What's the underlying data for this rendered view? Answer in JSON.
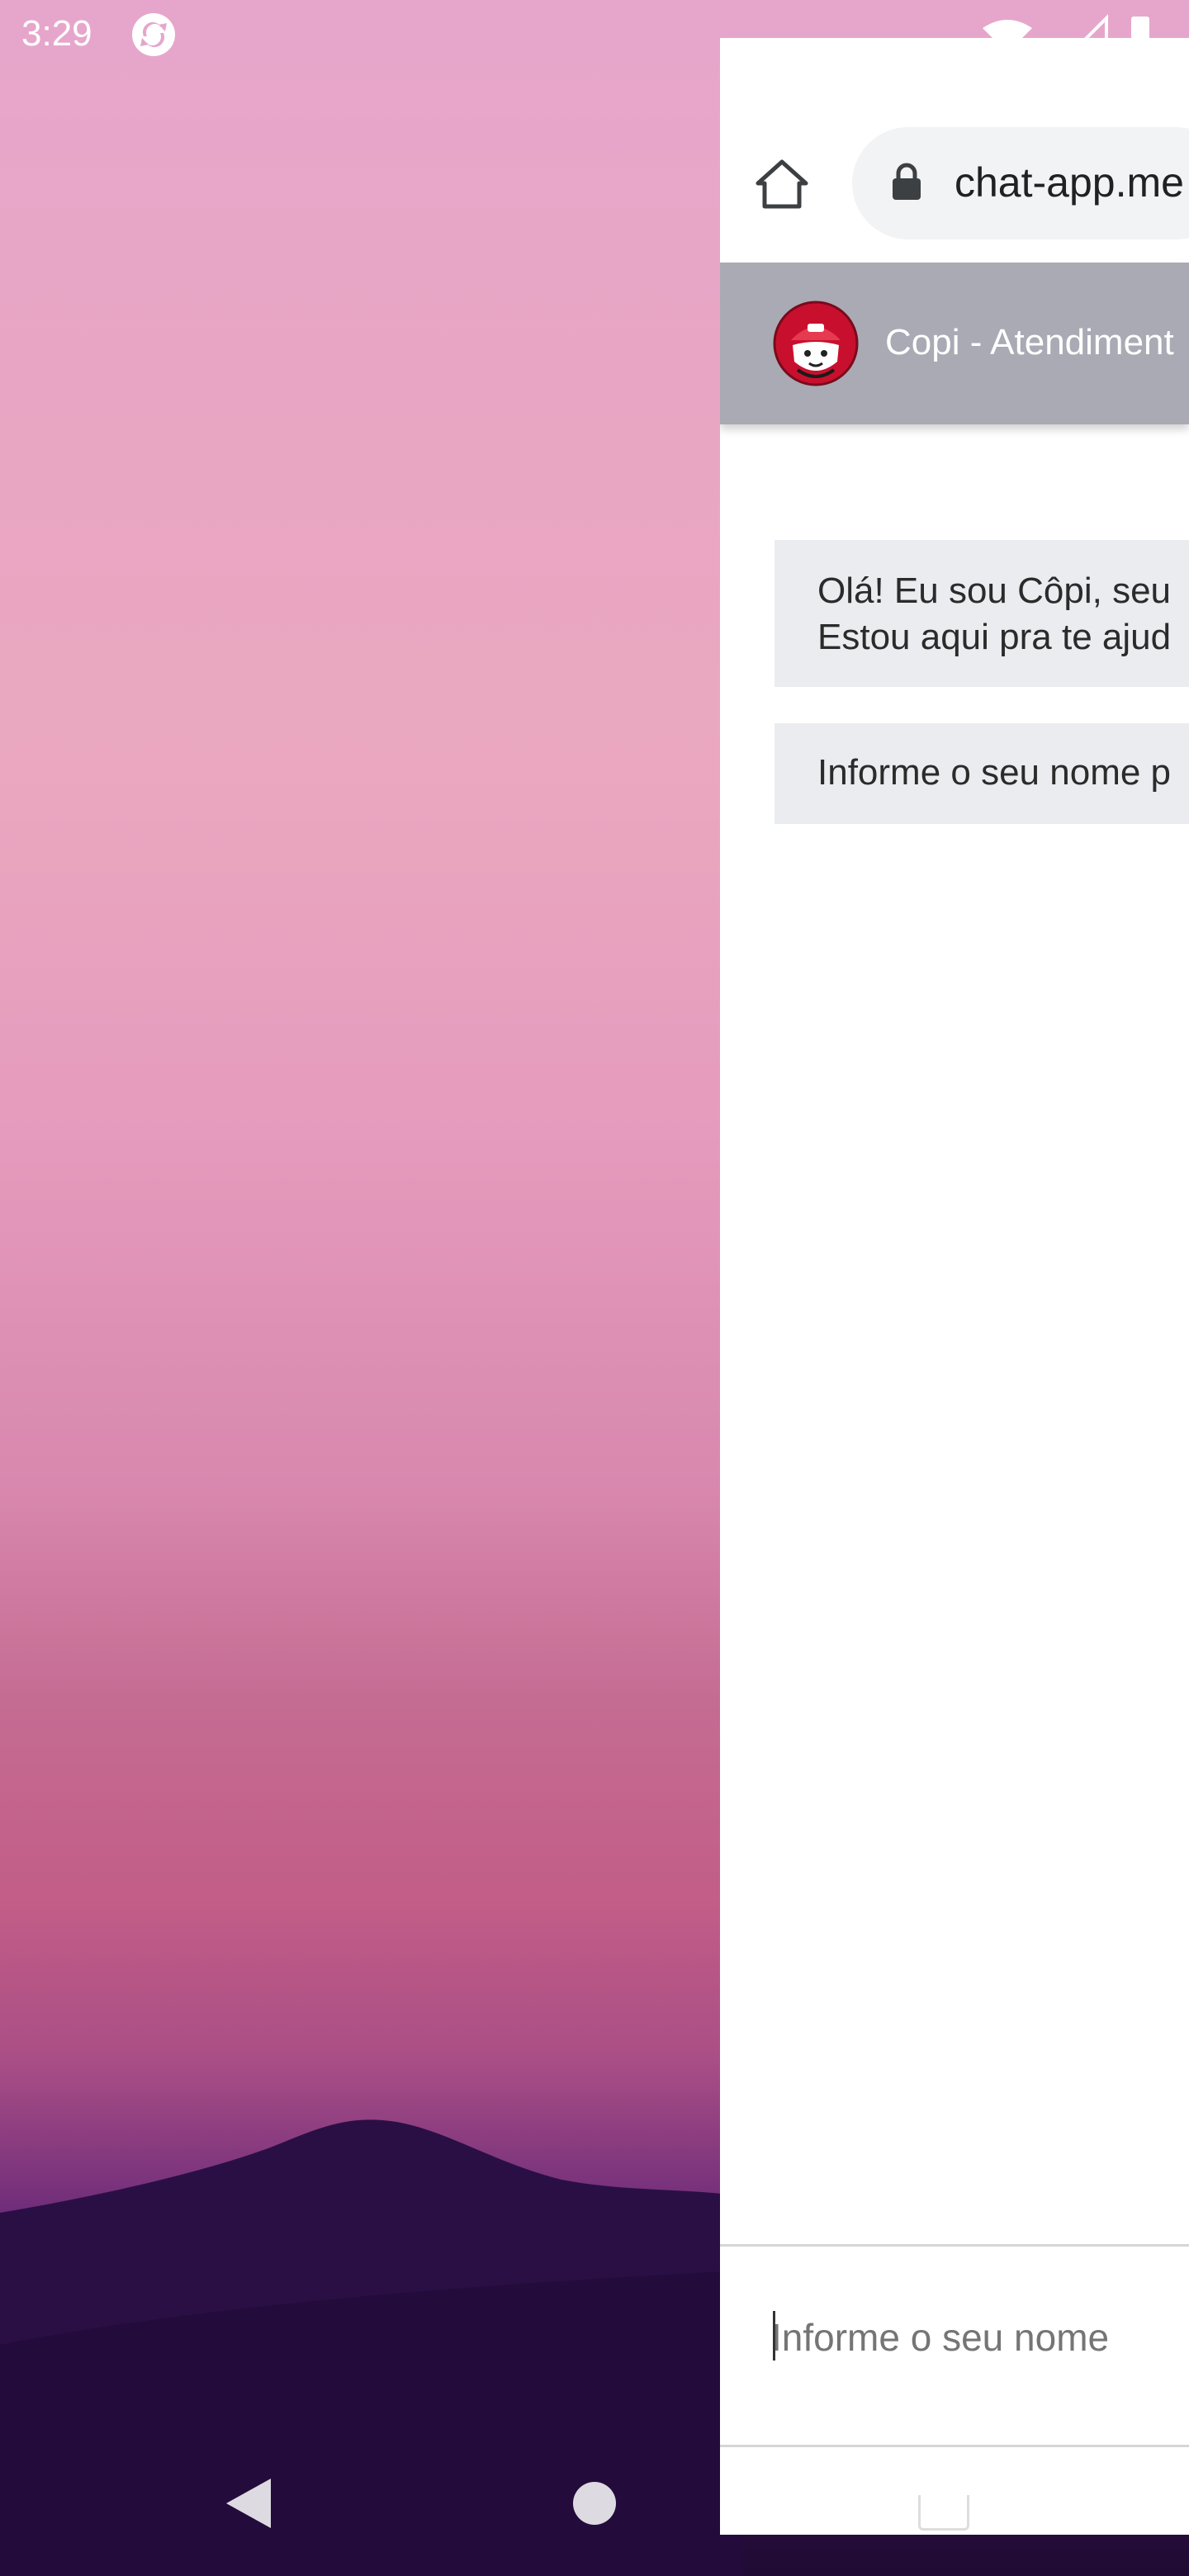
{
  "status_bar": {
    "time": "3:29",
    "app_icon": "sync-app-icon",
    "right_icons": [
      "wifi-icon",
      "signal-icon",
      "battery-icon"
    ]
  },
  "browser": {
    "home_icon": "home-icon",
    "lock_icon": "lock-icon",
    "url": "chat-app.me"
  },
  "chat": {
    "header_title": "Copi - Atendiment",
    "avatar_icon": "copi-avatar-icon",
    "messages": [
      {
        "lines": [
          "Olá! Eu sou Côpi, seu",
          "Estou aqui pra te ajud"
        ]
      },
      {
        "lines": [
          "Informe o seu nome p"
        ]
      }
    ],
    "composer_placeholder": "Informe o seu nome"
  },
  "nav_bar": {
    "icons": [
      "back-icon",
      "home-circle-icon"
    ]
  },
  "colors": {
    "chat_header": "#a9aab4",
    "bubble_bg": "#ebecf0",
    "url_bar_bg": "#f1f3f4"
  }
}
